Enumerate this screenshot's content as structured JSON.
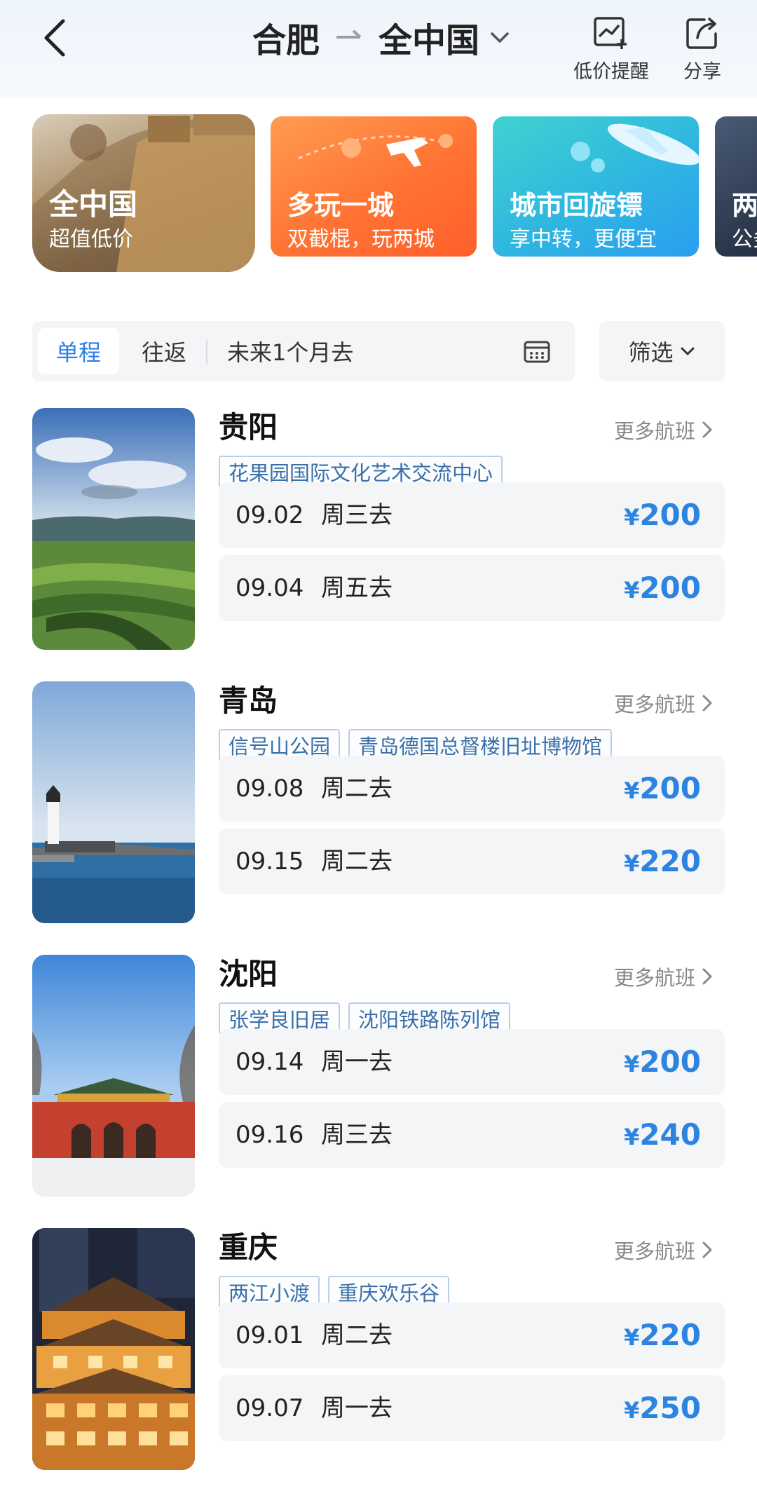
{
  "header": {
    "origin": "合肥",
    "destination": "全中国",
    "price_alert_label": "低价提醒",
    "share_label": "分享"
  },
  "promos": [
    {
      "title": "全中国",
      "subtitle": "超值低价"
    },
    {
      "title": "多玩一城",
      "subtitle": "双截棍，玩两城"
    },
    {
      "title": "城市回旋镖",
      "subtitle": "享中转，更便宜"
    },
    {
      "title": "两",
      "subtitle": "公务"
    }
  ],
  "filter": {
    "one_way": "单程",
    "round_trip": "往返",
    "date_range": "未来1个月去",
    "filter_label": "筛选"
  },
  "more_flights_label": "更多航班",
  "currency": "¥",
  "destinations": [
    {
      "city": "贵阳",
      "tags": [
        "花果园国际文化艺术交流中心"
      ],
      "flights": [
        {
          "date": "09.02",
          "day": "周三去",
          "price": "200"
        },
        {
          "date": "09.04",
          "day": "周五去",
          "price": "200"
        }
      ]
    },
    {
      "city": "青岛",
      "tags": [
        "信号山公园",
        "青岛德国总督楼旧址博物馆"
      ],
      "flights": [
        {
          "date": "09.08",
          "day": "周二去",
          "price": "200"
        },
        {
          "date": "09.15",
          "day": "周二去",
          "price": "220"
        }
      ]
    },
    {
      "city": "沈阳",
      "tags": [
        "张学良旧居",
        "沈阳铁路陈列馆"
      ],
      "flights": [
        {
          "date": "09.14",
          "day": "周一去",
          "price": "200"
        },
        {
          "date": "09.16",
          "day": "周三去",
          "price": "240"
        }
      ]
    },
    {
      "city": "重庆",
      "tags": [
        "两江小渡",
        "重庆欢乐谷"
      ],
      "flights": [
        {
          "date": "09.01",
          "day": "周二去",
          "price": "220"
        },
        {
          "date": "09.07",
          "day": "周一去",
          "price": "250"
        }
      ]
    }
  ],
  "colors": {
    "accent_blue": "#2d84e0",
    "tag_border": "#b9d0ea",
    "tag_text": "#3b6fa8",
    "row_bg": "#f4f5f7"
  }
}
